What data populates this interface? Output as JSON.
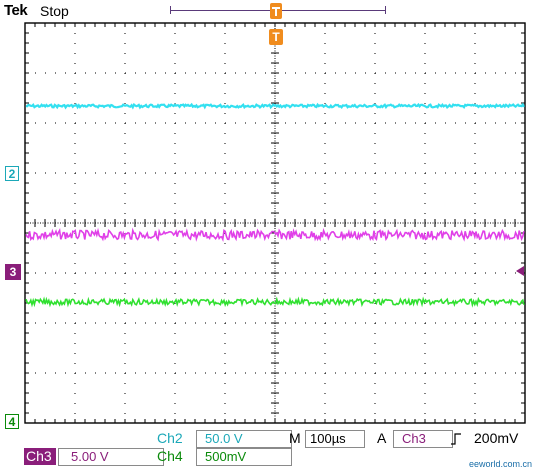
{
  "header": {
    "brand": "Tek",
    "status": "Stop",
    "trigger_marker": "T"
  },
  "channels": {
    "ch2": {
      "label": "Ch2",
      "scale": "50.0 V",
      "marker": "2",
      "color": "#33e0f0"
    },
    "ch3": {
      "label": "Ch3",
      "scale": "5.00 V",
      "marker": "3",
      "color": "#e040e8"
    },
    "ch4": {
      "label": "Ch4",
      "scale": "500mV",
      "marker": "4",
      "color": "#30e030"
    }
  },
  "timebase": {
    "label": "M",
    "value": "100µs"
  },
  "trigger": {
    "label": "A",
    "source": "Ch3",
    "slope_icon": "rising-edge-icon",
    "level": "200mV"
  },
  "watermark": "eeworld.com.cn",
  "colors": {
    "grid": "#000000",
    "ch3_badge_bg": "#8a1e7a",
    "trigger_marker": "#f08c1e",
    "ch2_text": "#1ca8b8",
    "ch4_text": "#0a8a0a",
    "ch3_text": "#8a1e7a"
  }
}
